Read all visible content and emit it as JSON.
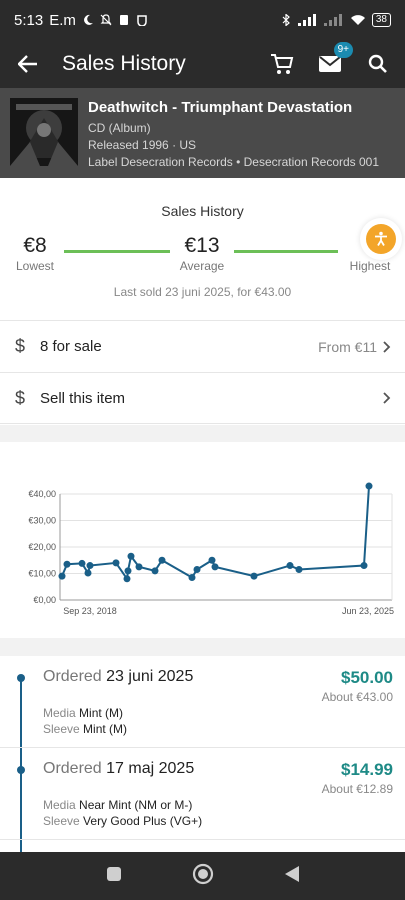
{
  "status_bar": {
    "time": "5:13",
    "carrier": "E.m",
    "battery": "38"
  },
  "app_bar": {
    "title": "Sales History",
    "messages_badge": "9+"
  },
  "release": {
    "title": "Deathwitch - Triumphant Devastation",
    "format": "CD (Album)",
    "released": "Released 1996 · US",
    "label": "Label Desecration Records • Desecration Records 001"
  },
  "summary": {
    "title": "Sales History",
    "lowest_value": "€8",
    "lowest_label": "Lowest",
    "average_value": "€13",
    "average_label": "Average",
    "highest_value": "€",
    "highest_label": "Highest",
    "last_sold": "Last sold 23 juni 2025, for €43.00"
  },
  "for_sale": {
    "label": "8 for sale",
    "from": "From €11"
  },
  "sell": {
    "label": "Sell this item"
  },
  "chart_data": {
    "type": "line",
    "x_tick_labels": [
      "Sep 23, 2018",
      "Jun 23, 2025"
    ],
    "y_tick_labels": [
      "€40,00",
      "€30,00",
      "€20,00",
      "€10,00",
      "€0,00"
    ],
    "ylim": [
      0,
      40
    ],
    "grid": true,
    "series_color": "#1a5f88",
    "values": [
      9,
      13.5,
      13.8,
      10.2,
      13,
      14,
      8,
      11,
      16.5,
      12.5,
      11,
      15,
      8.5,
      11.5,
      15,
      12.5,
      9,
      13,
      11.5,
      13,
      43
    ]
  },
  "orders": [
    {
      "ordered_label": "Ordered",
      "date": "23 juni 2025",
      "price": "$50.00",
      "about": "About €43.00",
      "media_label": "Media",
      "media": "Mint (M)",
      "sleeve_label": "Sleeve",
      "sleeve": "Mint (M)"
    },
    {
      "ordered_label": "Ordered",
      "date": "17 maj 2025",
      "price": "$14.99",
      "about": "About €12.89",
      "media_label": "Media",
      "media": "Near Mint (NM or M-)",
      "sleeve_label": "Sleeve",
      "sleeve": "Very Good Plus (VG+)"
    }
  ],
  "colors": {
    "accent": "#1e8a86",
    "timeline": "#1a5f88",
    "range_bar": "#6cbf57",
    "fab": "#f3a529"
  }
}
